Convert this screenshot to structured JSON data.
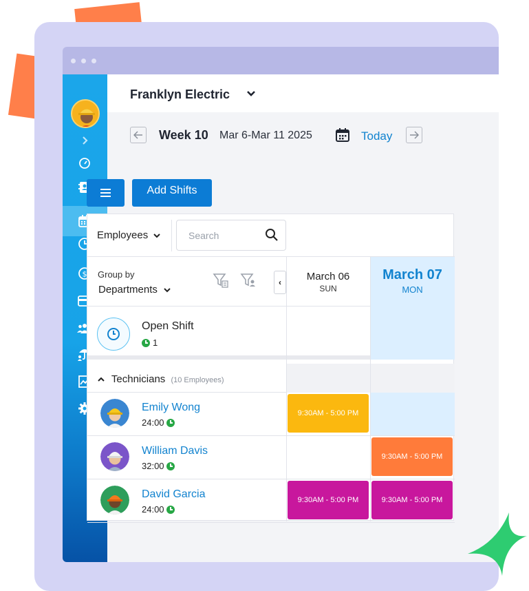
{
  "company": {
    "name": "Franklyn Electric"
  },
  "week": {
    "label": "Week 10",
    "range": "Mar 6-Mar 11 2025",
    "today_label": "Today"
  },
  "actions": {
    "add_shifts_label": "Add Shifts"
  },
  "toolbar": {
    "employees_label": "Employees",
    "search_placeholder": "Search"
  },
  "groupby": {
    "label": "Group by",
    "value": "Departments"
  },
  "days": [
    {
      "date": "March 06",
      "dow": "SUN"
    },
    {
      "date": "March 07",
      "dow": "MON"
    }
  ],
  "open_shift": {
    "title": "Open Shift",
    "count": "1"
  },
  "group": {
    "name": "Technicians",
    "count_label": "(10 Employees)"
  },
  "employees": [
    {
      "name": "Emily Wong",
      "hours": "24:00",
      "shifts": [
        "9:30AM - 5:00 PM",
        ""
      ]
    },
    {
      "name": "William Davis",
      "hours": "32:00",
      "shifts": [
        "",
        "9:30AM - 5:00 PM"
      ]
    },
    {
      "name": "David Garcia",
      "hours": "24:00",
      "shifts": [
        "9:30AM - 5:00 PM",
        "9:30AM - 5:00 PM"
      ]
    }
  ],
  "colors": {
    "primary": "#0c7cd5",
    "sidebar": "#1ba6ea",
    "shift_yellow": "#fbb80f",
    "shift_orange": "#ff7b3a",
    "shift_magenta": "#c8179d",
    "success": "#27a745"
  },
  "sidebar_icons": [
    "chevron-right-icon",
    "dashboard-gauge-icon",
    "contacts-book-icon",
    "calendar-icon",
    "clock-icon",
    "dollar-icon",
    "card-icon",
    "team-icon",
    "umbrella-icon",
    "chart-icon",
    "settings-gear-icon"
  ]
}
